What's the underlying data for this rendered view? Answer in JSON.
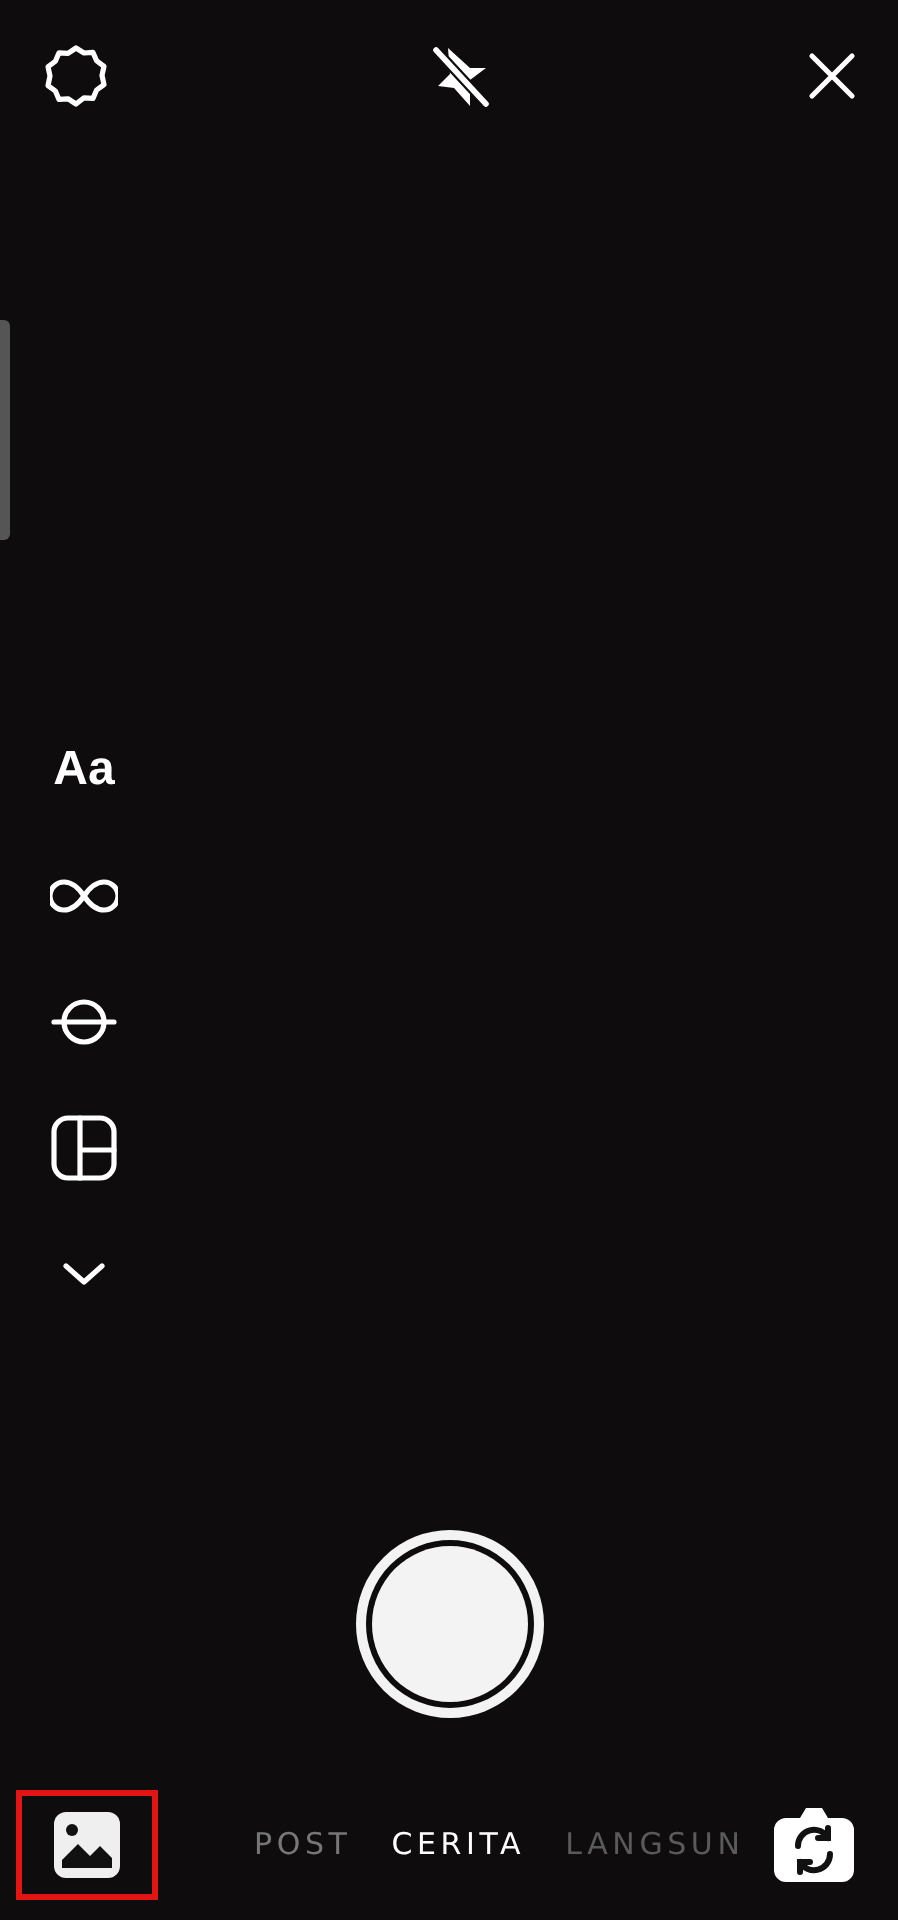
{
  "side_tools": [
    {
      "kind": "text",
      "label": "Aa"
    },
    {
      "kind": "boomerang"
    },
    {
      "kind": "level"
    },
    {
      "kind": "layout"
    },
    {
      "kind": "more"
    }
  ],
  "modes": [
    {
      "label": "POST",
      "selected": false
    },
    {
      "label": "CERITA",
      "selected": true
    },
    {
      "label": "LANGSUN",
      "selected": false
    }
  ]
}
